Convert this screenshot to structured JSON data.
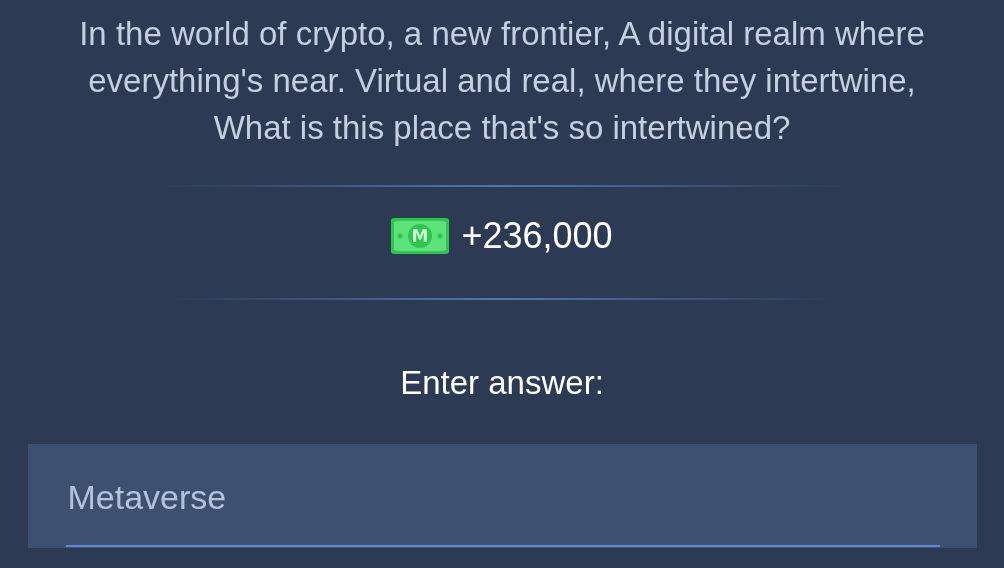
{
  "riddle": "In the world of crypto, a new frontier, A digital realm where everything's near. Virtual and real, where they intertwine, What is this place that's so intertwined?",
  "reward": {
    "amount": "+236,000",
    "icon_letter": "M"
  },
  "answer_label": "Enter answer:",
  "answer_field": {
    "value": "Metaverse"
  }
}
